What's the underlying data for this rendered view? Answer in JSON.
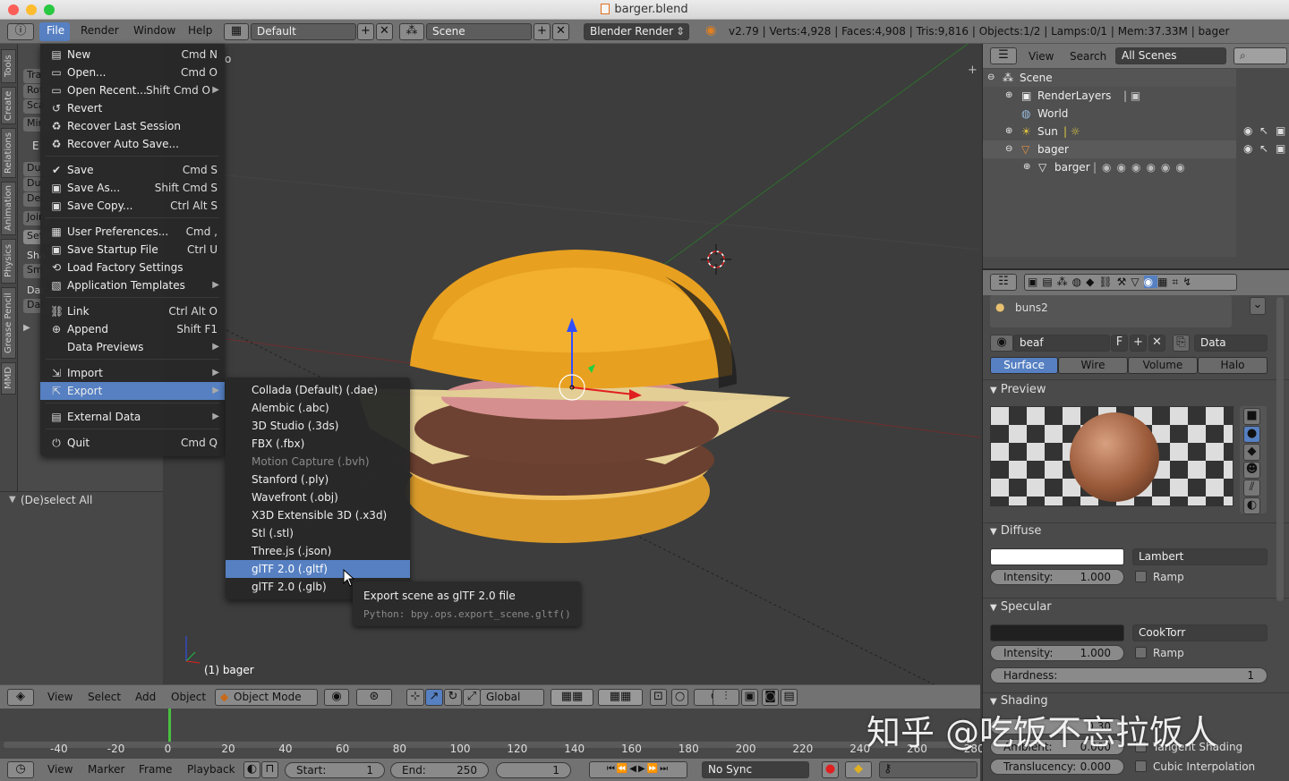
{
  "window": {
    "title": "barger.blend"
  },
  "topbar": {
    "menus": [
      "File",
      "Render",
      "Window",
      "Help"
    ],
    "layout": "Default",
    "scene": "Scene",
    "engine": "Blender Render",
    "stats": "v2.79 | Verts:4,928 | Faces:4,908 | Tris:9,816 | Objects:1/2 | Lamps:0/1 | Mem:37.33M | bager"
  },
  "left_tabs": [
    "Tools",
    "Create",
    "Relations",
    "Animation",
    "Physics",
    "Grease Pencil",
    "MMD"
  ],
  "toolshelf": {
    "partial_items": [
      "Tra",
      "Rot",
      "Sca",
      "Mir",
      "E",
      "Du",
      "Du",
      "Del",
      "Join",
      "Set",
      "Sha",
      "Sm",
      "Dat",
      "Dat"
    ],
    "redo_title": "(De)select All"
  },
  "file_menu": {
    "items": [
      {
        "label": "New",
        "shortcut": "Cmd N",
        "icon": "new-file-icon"
      },
      {
        "label": "Open...",
        "shortcut": "Cmd O",
        "icon": "folder-icon"
      },
      {
        "label": "Open Recent...",
        "shortcut": "Shift Cmd O",
        "icon": "folder-icon",
        "submenu": true
      },
      {
        "label": "Revert",
        "shortcut": "",
        "icon": "revert-icon"
      },
      {
        "label": "Recover Last Session",
        "shortcut": "",
        "icon": "recover-icon"
      },
      {
        "label": "Recover Auto Save...",
        "shortcut": "",
        "icon": "recover-icon"
      },
      {
        "label": "Save",
        "shortcut": "Cmd S",
        "icon": "check-icon"
      },
      {
        "label": "Save As...",
        "shortcut": "Shift Cmd S",
        "icon": "save-icon"
      },
      {
        "label": "Save Copy...",
        "shortcut": "Ctrl Alt S",
        "icon": "save-icon"
      },
      {
        "label": "User Preferences...",
        "shortcut": "Cmd ,",
        "icon": "prefs-icon"
      },
      {
        "label": "Save Startup File",
        "shortcut": "Ctrl U",
        "icon": "save-icon"
      },
      {
        "label": "Load Factory Settings",
        "shortcut": "",
        "icon": "load-icon"
      },
      {
        "label": "Application Templates",
        "shortcut": "",
        "icon": "template-icon",
        "submenu": true
      },
      {
        "label": "Link",
        "shortcut": "Ctrl Alt O",
        "icon": "link-icon"
      },
      {
        "label": "Append",
        "shortcut": "Shift F1",
        "icon": "append-icon"
      },
      {
        "label": "Data Previews",
        "shortcut": "",
        "icon": "",
        "submenu": true
      },
      {
        "label": "Import",
        "shortcut": "",
        "icon": "import-icon",
        "submenu": true
      },
      {
        "label": "Export",
        "shortcut": "",
        "icon": "export-icon",
        "submenu": true,
        "selected": true
      },
      {
        "label": "External Data",
        "shortcut": "",
        "icon": "external-data-icon",
        "submenu": true
      },
      {
        "label": "Quit",
        "shortcut": "Cmd Q",
        "icon": "power-icon"
      }
    ]
  },
  "export_menu": {
    "items": [
      {
        "label": "Collada (Default) (.dae)"
      },
      {
        "label": "Alembic (.abc)"
      },
      {
        "label": "3D Studio (.3ds)"
      },
      {
        "label": "FBX (.fbx)"
      },
      {
        "label": "Motion Capture (.bvh)",
        "disabled": true
      },
      {
        "label": "Stanford (.ply)"
      },
      {
        "label": "Wavefront (.obj)"
      },
      {
        "label": "X3D Extensible 3D (.x3d)"
      },
      {
        "label": "Stl (.stl)"
      },
      {
        "label": "Three.js (.json)"
      },
      {
        "label": "glTF 2.0 (.gltf)",
        "selected": true
      },
      {
        "label": "glTF 2.0 (.glb)"
      }
    ]
  },
  "tooltip": {
    "title": "Export scene as glTF 2.0 file",
    "python": "Python: bpy.ops.export_scene.gltf()"
  },
  "viewport": {
    "object_label": "(1) bager",
    "partial_text": "o"
  },
  "viewport_header": {
    "view": "View",
    "select": "Select",
    "add": "Add",
    "object": "Object",
    "mode": "Object Mode",
    "orientation": "Global"
  },
  "timeline": {
    "ticks": [
      "-40",
      "-20",
      "0",
      "20",
      "40",
      "60",
      "80",
      "100",
      "120",
      "140",
      "160",
      "180",
      "200",
      "220",
      "240",
      "260",
      "280"
    ],
    "current_frame": 0
  },
  "timeline_header": {
    "view": "View",
    "marker": "Marker",
    "frame": "Frame",
    "playback": "Playback",
    "start_label": "Start:",
    "start": "1",
    "end_label": "End:",
    "end": "250",
    "current": "1",
    "sync": "No Sync"
  },
  "outliner": {
    "header": {
      "view": "View",
      "search": "Search",
      "filter": "All Scenes"
    },
    "rows": [
      {
        "label": "Scene",
        "depth": 0
      },
      {
        "label": "RenderLayers",
        "depth": 1
      },
      {
        "label": "World",
        "depth": 1
      },
      {
        "label": "Sun",
        "depth": 1
      },
      {
        "label": "bager",
        "depth": 1,
        "highlight": true
      },
      {
        "label": "barger",
        "depth": 2
      }
    ]
  },
  "properties": {
    "material_slot": "buns2",
    "material_name": "beaf",
    "fake_user": "F",
    "data_select": "Data",
    "tabs": [
      "Surface",
      "Wire",
      "Volume",
      "Halo"
    ],
    "active_tab": "Surface",
    "preview_label": "Preview",
    "diffuse": {
      "label": "Diffuse",
      "shader": "Lambert",
      "intensity_label": "Intensity:",
      "intensity": "1.000",
      "ramp": "Ramp",
      "color": "#ffffff"
    },
    "specular": {
      "label": "Specular",
      "shader": "CookTorr",
      "intensity_label": "Intensity:",
      "intensity": "1.000",
      "ramp": "Ramp",
      "hardness_label": "Hardness:",
      "hardness": "1",
      "color": "#202020"
    },
    "shading": {
      "label": "Shading",
      "emit_partial": "0.30",
      "ambient_label": "Ambient:",
      "ambient": "0.000",
      "tangent": "Tangent Shading",
      "translucency_label": "Translucency:",
      "translucency": "0.000",
      "cubic": "Cubic Interpolation"
    }
  },
  "watermark": "知乎 @吃饭不忘拉饭人",
  "colors": {
    "accent": "#5680c2",
    "menu_bg": "#282828",
    "header": "#727272"
  }
}
